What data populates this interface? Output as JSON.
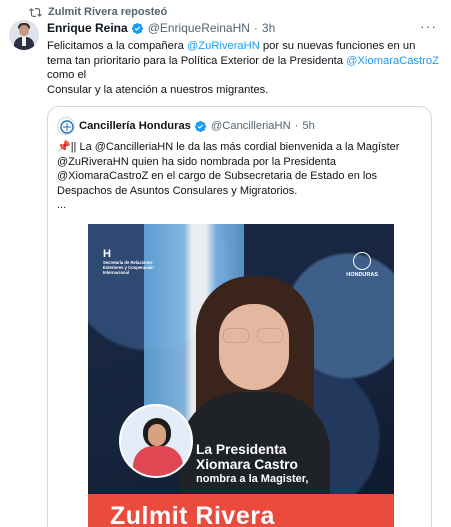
{
  "repost": {
    "label": "Zulmit Rivera reposteó",
    "icon": "repost-icon"
  },
  "tweet": {
    "author_name": "Enrique Reina",
    "handle": "@EnriqueReinaHN",
    "separator": "·",
    "time": "3h",
    "more_label": "···",
    "text": {
      "l1_prefix": "Felicitamos a la compañera ",
      "l1_mention": "@ZuRiveraHN",
      "l1_suffix": " por su nuevas funciones en un",
      "l2_prefix": "tema tan prioritario para la Política Exterior de la Presidenta ",
      "l2_mention": "@XiomaraCastroZ",
      "l3": "como el",
      "l4": "Consular y la atención a nuestros migrantes."
    }
  },
  "quote": {
    "author_name": "Cancillería Honduras",
    "handle": "@CancilleriaHN",
    "separator": "·",
    "time": "5h",
    "text": {
      "pin": "📌",
      "l1_prefix": "|| La ",
      "l1_mention": "@CancilleriaHN",
      "l1_suffix": "  le da las más cordial bienvenida a la Magíster",
      "l2": "@ZuRiveraHN quien ha sido nombrada por la Presidenta",
      "l3": "@XiomaraCastroZ en el cargo de Subsecretaria de Estado en los",
      "l4": "Despachos de Asuntos Consulares y Migratorios.",
      "l5": "..."
    },
    "image": {
      "logo_left_mark": "H",
      "logo_left_text": "Secretaría de Relaciones Exteriores y Cooperación Internacional",
      "logo_right_text": "HONDURAS",
      "caption_l1": "La Presidenta",
      "caption_l2": "Xiomara Castro",
      "caption_l3": "nombra a la Magister,",
      "banner_name": "Zulmit Rivera"
    }
  },
  "colors": {
    "accent": "#1d9bf0",
    "verified": "#1d9bf0",
    "banner": "#ea4b3c"
  }
}
